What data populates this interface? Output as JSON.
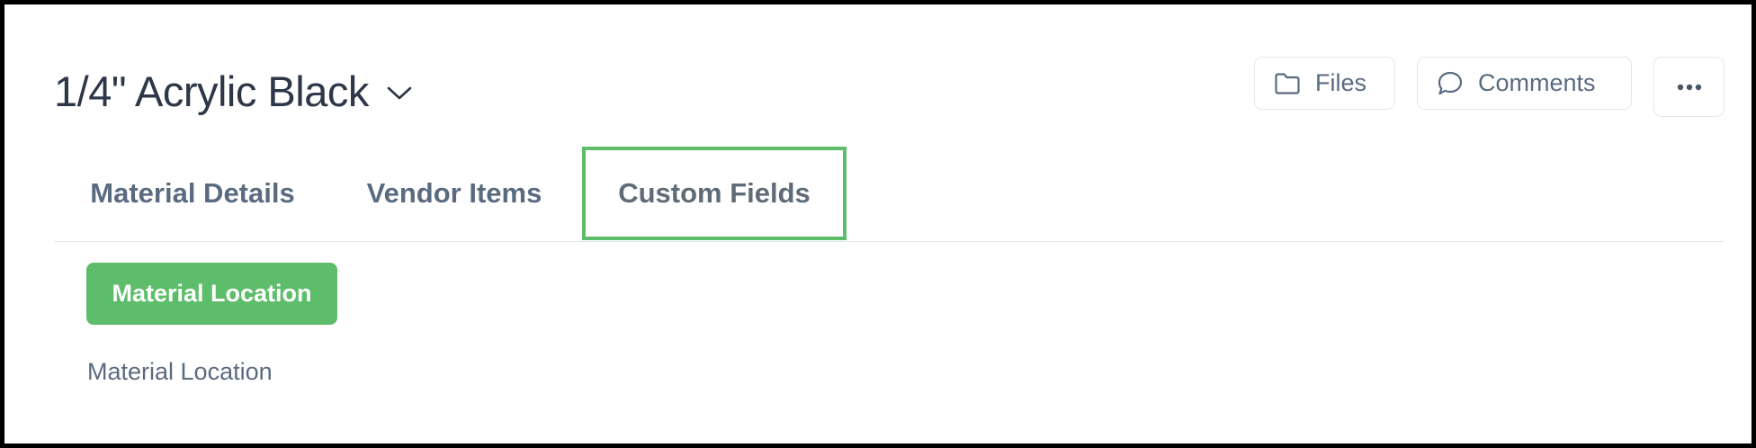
{
  "header": {
    "title": "1/4\" Acrylic Black",
    "title_dropdown_icon": "chevron-down-icon"
  },
  "actions": {
    "files_label": "Files",
    "files_icon": "folder-icon",
    "comments_label": "Comments",
    "comments_icon": "speech-bubble-icon",
    "more_icon": "ellipsis-icon"
  },
  "tabs": [
    {
      "label": "Material Details",
      "active": false
    },
    {
      "label": "Vendor Items",
      "active": false
    },
    {
      "label": "Custom Fields",
      "active": true
    }
  ],
  "custom_fields": {
    "group_button_label": "Material Location",
    "field_label": "Material Location"
  },
  "colors": {
    "accent": "#5dbd6a",
    "title_text": "#2d3748",
    "muted_text": "#5a6b80",
    "border": "#e2e8f0"
  }
}
